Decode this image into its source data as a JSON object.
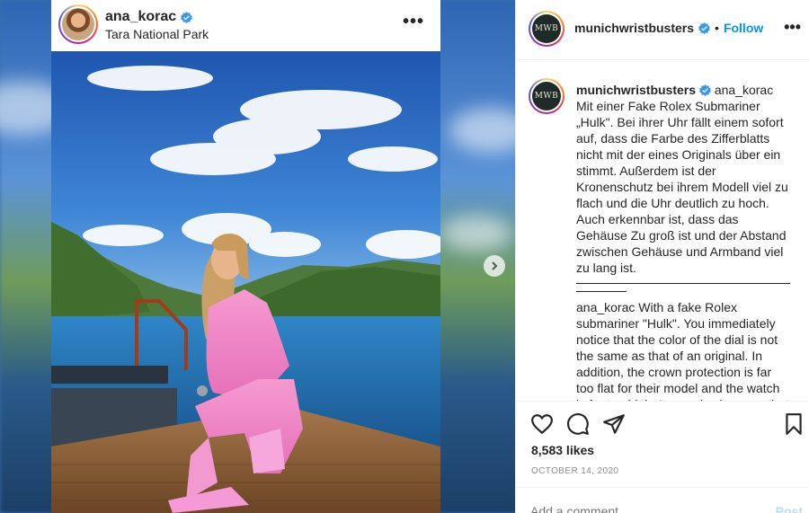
{
  "post": {
    "username": "ana_korac",
    "location": "Tara National Park",
    "more_icon": "more-horizontal-icon"
  },
  "side": {
    "account": "munichwristbusters",
    "logo_text": "MWB",
    "bullet": "•",
    "follow_label": "Follow",
    "caption": {
      "username": "munichwristbusters",
      "german": "ana_korac Mit einer Fake Rolex Submariner „Hulk\". Bei ihrer Uhr fällt einem sofort auf, dass die Farbe des Zifferblatts nicht mit der eines Originals über ein stimmt. Außerdem ist der Kronenschutz bei ihrem Modell viel zu flach und die Uhr deutlich zu hoch. Auch erkennbar ist, dass das Gehäuse Zu groß ist und der Abstand zwischen Gehäuse und Armband viel zu lang ist.",
      "english": "ana_korac With a fake Rolex submariner \"Hulk\". You immediately notice that the color of the dial is not the same as that of an original. In addition, the crown protection is far too flat for their model and the watch is far too high. It can also be seen that"
    },
    "likes": "8,583 likes",
    "date": "OCTOBER 14, 2020",
    "comment_placeholder": "Add a comment...",
    "post_label": "Post"
  },
  "colors": {
    "accent": "#0095f6",
    "post_disabled": "#b2dffc",
    "text": "#262626",
    "muted": "#8e8e8e"
  },
  "icons": [
    "heart-icon",
    "comment-icon",
    "share-icon",
    "bookmark-icon",
    "verified-badge-icon",
    "chevron-right-icon"
  ]
}
